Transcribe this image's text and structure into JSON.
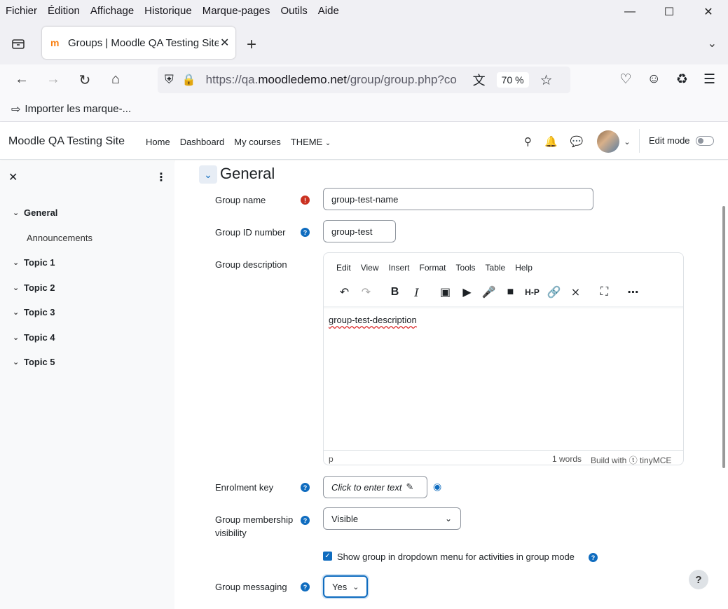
{
  "browser": {
    "menu": [
      "Fichier",
      "Édition",
      "Affichage",
      "Historique",
      "Marque-pages",
      "Outils",
      "Aide"
    ],
    "tab_title": "Groups | Moodle QA Testing Site",
    "url_prefix": "https://qa.",
    "url_domain": "moodledemo.net",
    "url_path": "/group/group.php?co",
    "zoom": "70 %",
    "bookmark": "Importer les marque-..."
  },
  "moodle": {
    "site_name": "Moodle QA Testing Site",
    "links": [
      "Home",
      "Dashboard",
      "My courses",
      "THEME"
    ],
    "edit_mode": "Edit mode"
  },
  "drawer": {
    "sections": [
      {
        "label": "General"
      },
      {
        "label": "Topic 1"
      },
      {
        "label": "Topic 2"
      },
      {
        "label": "Topic 3"
      },
      {
        "label": "Topic 4"
      },
      {
        "label": "Topic 5"
      }
    ],
    "sub_item": "Announcements"
  },
  "form": {
    "section_title": "General",
    "group_name_label": "Group name",
    "group_name_value": "group-test-name",
    "group_id_label": "Group ID number",
    "group_id_value": "group-test",
    "description_label": "Group description",
    "editor_menu": [
      "Edit",
      "View",
      "Insert",
      "Format",
      "Tools",
      "Table",
      "Help"
    ],
    "description_value": "group-test-description",
    "editor_path": "p",
    "editor_words": "1 words",
    "editor_build": "Build with ⓣ tinyMCE",
    "enrolment_key_label": "Enrolment key",
    "enrolment_key_placeholder": "Click to enter text",
    "membership_label": "Group membership visibility",
    "membership_value": "Visible",
    "show_in_dropdown_label": "Show group in dropdown menu for activities in group mode",
    "show_in_dropdown_checked": true,
    "messaging_label": "Group messaging",
    "messaging_value": "Yes"
  }
}
